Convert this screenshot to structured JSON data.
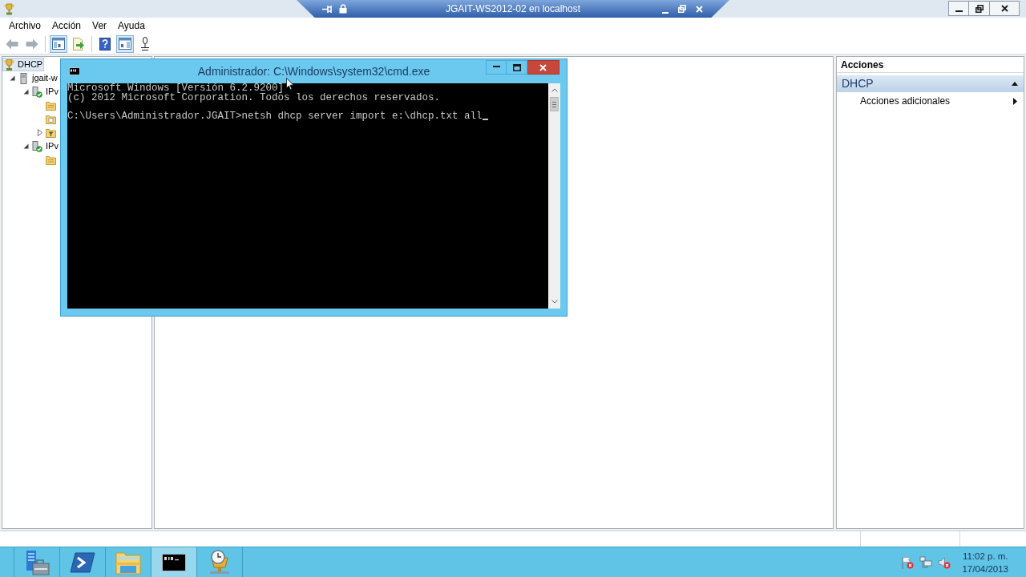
{
  "remote_bar": {
    "title": "JGAIT-WS2012-02 en localhost"
  },
  "menu": [
    "Archivo",
    "Acción",
    "Ver",
    "Ayuda"
  ],
  "toolbar": [
    [
      {
        "kind": "back",
        "disabled": true,
        "on": false
      },
      {
        "kind": "forward",
        "disabled": true,
        "on": false
      }
    ],
    [
      {
        "kind": "tree-toggle",
        "disabled": false,
        "on": true
      },
      {
        "kind": "export",
        "disabled": false,
        "on": false
      }
    ],
    [
      {
        "kind": "help",
        "disabled": false,
        "on": false
      },
      {
        "kind": "pane-toggle",
        "disabled": false,
        "on": true
      },
      {
        "kind": "connect",
        "disabled": false,
        "on": false
      }
    ]
  ],
  "tree": [
    {
      "kind": "dhcp",
      "label": "DHCP",
      "selected": true,
      "children": [
        {
          "kind": "server",
          "label": "jgait-w",
          "selected": false,
          "expanded": true,
          "children": [
            {
              "kind": "protocol",
              "label": "IPv",
              "selected": false,
              "expanded": true,
              "children": [
                {
                  "kind": "folder",
                  "selected": false
                },
                {
                  "kind": "folder-doc",
                  "selected": false
                },
                {
                  "kind": "filter",
                  "selected": false,
                  "expanded": false
                }
              ]
            },
            {
              "kind": "protocol",
              "label": "IPv",
              "selected": false,
              "expanded": true,
              "children": [
                {
                  "kind": "folder",
                  "selected": false
                }
              ]
            }
          ]
        }
      ]
    }
  ],
  "actions": {
    "title": "Acciones",
    "sections": [
      {
        "title": "DHCP",
        "expanded": true,
        "items": [
          {
            "label": "Acciones adicionales",
            "submenu": true
          }
        ]
      }
    ]
  },
  "console": {
    "title": "Administrador: C:\\Windows\\system32\\cmd.exe",
    "blocks": [
      [
        "Microsoft Windows [Versión 6.2.9200]",
        "(c) 2012 Microsoft Corporation. Todos los derechos reservados."
      ],
      [
        "C:\\Users\\Administrador.JGAIT>netsh dhcp server import e:\\dhcp.txt all"
      ]
    ],
    "cursor": true
  },
  "taskbar": {
    "buttons": [
      {
        "kind": "server-manager",
        "selected": false
      },
      {
        "kind": "powershell",
        "selected": false
      },
      {
        "kind": "explorer",
        "selected": false
      },
      {
        "kind": "console",
        "selected": true
      },
      {
        "kind": "dhcp",
        "selected": false
      }
    ],
    "tray": [
      {
        "kind": "flag",
        "alert": true
      },
      {
        "kind": "network",
        "alert": false
      },
      {
        "kind": "speaker",
        "alert": true
      }
    ],
    "time": "11:02 p. m.",
    "date": "17/04/2013"
  }
}
